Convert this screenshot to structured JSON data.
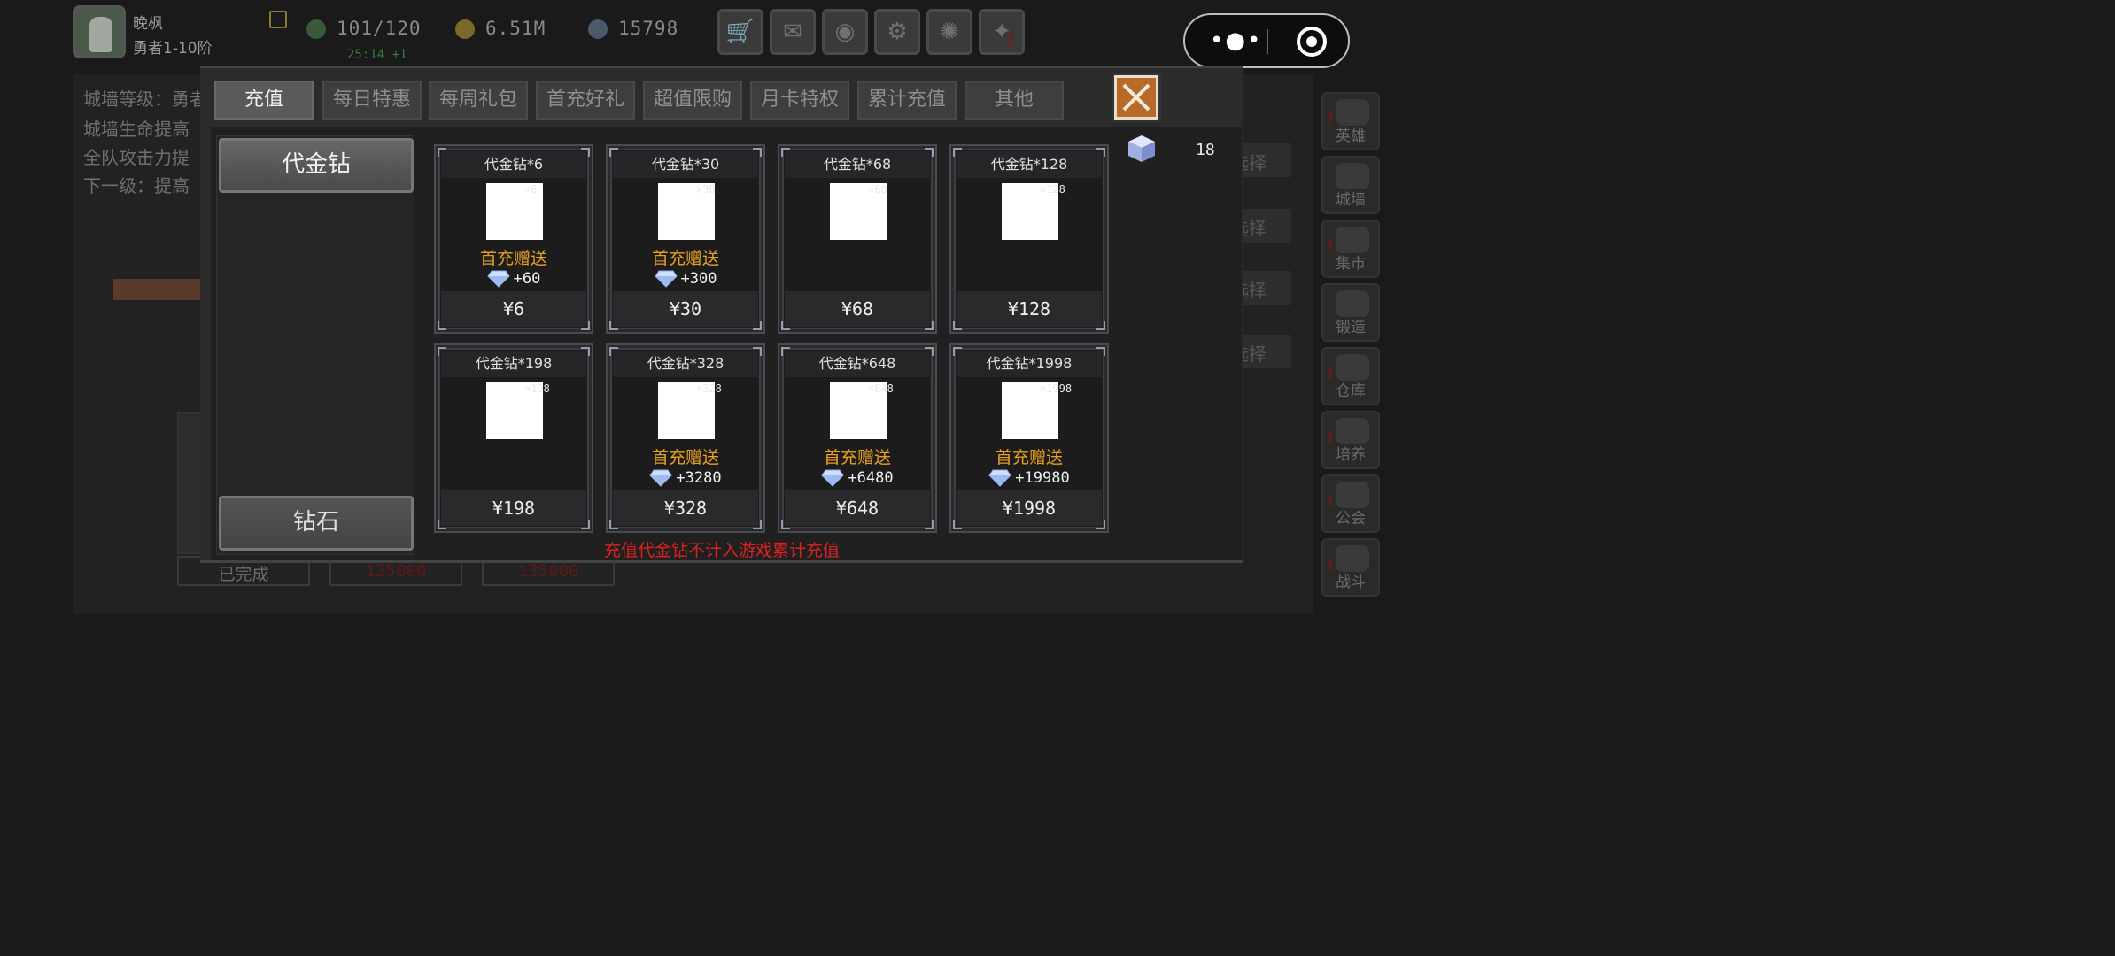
{
  "player": {
    "name": "晚枫",
    "rank": "勇者1-10阶",
    "energy": "101/120",
    "energy_timer": "25:14 +1",
    "gold": "6.51M",
    "gems": "15798"
  },
  "toolbar": {
    "buttons": [
      "cart-icon",
      "mail-icon",
      "gamepad-icon",
      "settings-icon",
      "pinwheel-icon",
      "fireworks-icon"
    ]
  },
  "background": {
    "lines": [
      "城墙等级：勇者",
      "城墙生命提高",
      "全队攻击力提",
      "下一级：提高"
    ],
    "select_label": "选择",
    "completed": "已完成",
    "cost1": "135000",
    "cost2": "135000",
    "sidebar": [
      "英雄",
      "城墙",
      "集市",
      "锻造",
      "仓库",
      "培养",
      "公会",
      "战斗"
    ]
  },
  "tabs": [
    "充值",
    "每日特惠",
    "每周礼包",
    "首充好礼",
    "超值限购",
    "月卡特权",
    "累计充值",
    "其他"
  ],
  "categories": {
    "top": "代金钻",
    "bottom": "钻石"
  },
  "balance": "18",
  "products": [
    {
      "title": "代金钻*6",
      "qty": "×6",
      "bonus_label": "首充赠送",
      "bonus_gems": "+60",
      "price": "¥6"
    },
    {
      "title": "代金钻*30",
      "qty": "×30",
      "bonus_label": "首充赠送",
      "bonus_gems": "+300",
      "price": "¥30"
    },
    {
      "title": "代金钻*68",
      "qty": "×68",
      "bonus_label": "",
      "bonus_gems": "",
      "price": "¥68"
    },
    {
      "title": "代金钻*128",
      "qty": "×128",
      "bonus_label": "",
      "bonus_gems": "",
      "price": "¥128"
    },
    {
      "title": "代金钻*198",
      "qty": "×198",
      "bonus_label": "",
      "bonus_gems": "",
      "price": "¥198"
    },
    {
      "title": "代金钻*328",
      "qty": "×328",
      "bonus_label": "首充赠送",
      "bonus_gems": "+3280",
      "price": "¥328"
    },
    {
      "title": "代金钻*648",
      "qty": "×648",
      "bonus_label": "首充赠送",
      "bonus_gems": "+6480",
      "price": "¥648"
    },
    {
      "title": "代金钻*1998",
      "qty": "×1998",
      "bonus_label": "首充赠送",
      "bonus_gems": "+19980",
      "price": "¥1998"
    }
  ],
  "notice": "充值代金钻不计入游戏累计充值",
  "colors": {
    "bonus": "#e8a020",
    "notice": "#e02020",
    "close_button": "#b86a2a"
  }
}
